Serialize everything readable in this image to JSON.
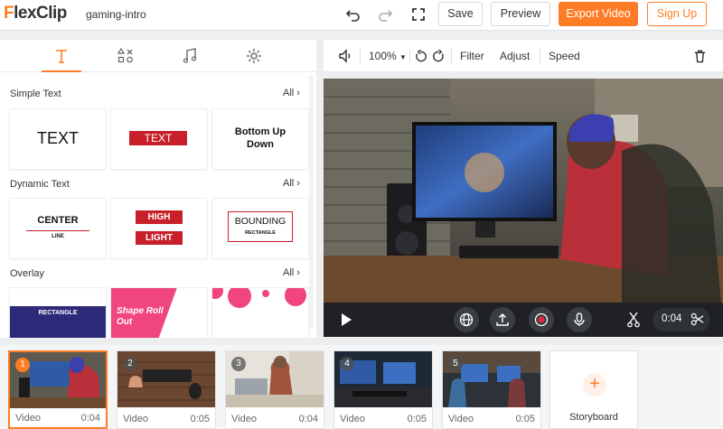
{
  "app": {
    "logo_f": "F",
    "logo_rest": "lexClip",
    "project_name": "gaming-intro"
  },
  "topbar": {
    "save_label": "Save",
    "preview_label": "Preview",
    "export_label": "Export Video",
    "signup_label": "Sign Up"
  },
  "left_panel": {
    "tabs": [
      {
        "icon": "text-icon"
      },
      {
        "icon": "elements-icon"
      },
      {
        "icon": "music-icon"
      },
      {
        "icon": "settings-icon"
      }
    ],
    "sections": [
      {
        "title": "Simple Text",
        "all_label": "All",
        "cards": [
          {
            "text": "TEXT"
          },
          {
            "text": "TEXT"
          },
          {
            "text": "Bottom Up Down"
          }
        ]
      },
      {
        "title": "Dynamic Text",
        "all_label": "All",
        "cards": [
          {
            "text": "CENTER",
            "sub": "LINE"
          },
          {
            "text": "HIGH",
            "sub": "LIGHT"
          },
          {
            "text": "BOUNDING",
            "sub": "RECTANGLE"
          }
        ]
      },
      {
        "title": "Overlay",
        "all_label": "All",
        "cards": [
          {
            "text": "RECTANGLE",
            "sub": ""
          },
          {
            "text": "Shape Roll Out"
          },
          {
            "text": ""
          }
        ]
      }
    ]
  },
  "preview_toolbar": {
    "zoom": "100%",
    "filter": "Filter",
    "adjust": "Adjust",
    "speed": "Speed"
  },
  "playback": {
    "time": "0:04"
  },
  "timeline": {
    "clips": [
      {
        "num": "1",
        "label": "Video",
        "duration": "0:04",
        "active": true
      },
      {
        "num": "2",
        "label": "Video",
        "duration": "0:05",
        "active": false
      },
      {
        "num": "3",
        "label": "Video",
        "duration": "0:04",
        "active": false
      },
      {
        "num": "4",
        "label": "Video",
        "duration": "0:05",
        "active": false
      },
      {
        "num": "5",
        "label": "Video",
        "duration": "0:05",
        "active": false
      }
    ],
    "storyboard_label": "Storyboard",
    "storyboard_plus": "+"
  },
  "colors": {
    "accent": "#ff7c26",
    "red_label": "#c8202a",
    "pink": "#f0457e"
  }
}
